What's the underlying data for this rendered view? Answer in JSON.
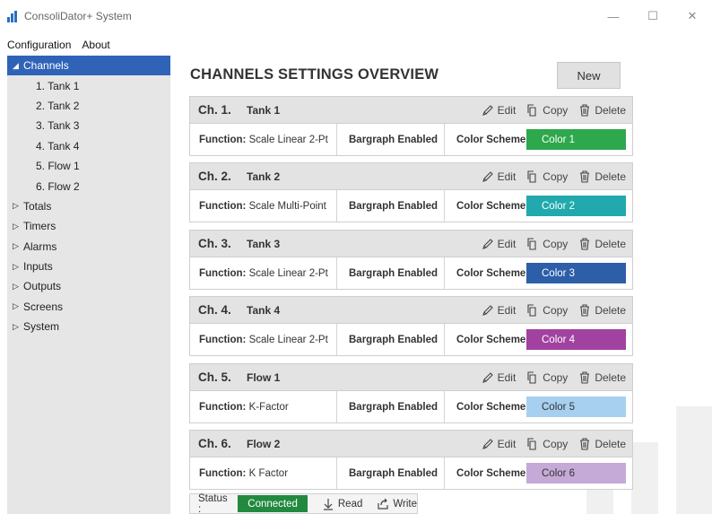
{
  "window": {
    "title": "ConsoliDator+ System",
    "minimize": "—",
    "maximize": "☐",
    "close": "✕"
  },
  "menu": {
    "items": [
      "Configuration",
      "About"
    ]
  },
  "sidebar": {
    "channels_label": "Channels",
    "channel_items": [
      "1. Tank 1",
      "2. Tank 2",
      "3. Tank  3",
      "4. Tank 4",
      "5. Flow 1",
      "6. Flow 2"
    ],
    "groups": [
      "Totals",
      "Timers",
      "Alarms",
      "Inputs",
      "Outputs",
      "Screens",
      "System"
    ]
  },
  "main": {
    "title": "CHANNELS SETTINGS OVERVIEW",
    "new_label": "New",
    "labels": {
      "edit": "Edit",
      "copy": "Copy",
      "delete": "Delete",
      "function": "Function:",
      "color_scheme": "Color Scheme:"
    },
    "channels": [
      {
        "num": "Ch. 1.",
        "name": "Tank 1",
        "function": "Scale Linear 2-Pt",
        "bargraph": "Bargraph Enabled",
        "color_label": "Color 1",
        "color": "#2ea84c",
        "text_color": "#ffffff"
      },
      {
        "num": "Ch. 2.",
        "name": "Tank 2",
        "function": "Scale Multi-Point",
        "bargraph": "Bargraph Enabled",
        "color_label": "Color 2",
        "color": "#22a9ad",
        "text_color": "#ffffff"
      },
      {
        "num": "Ch. 3.",
        "name": "Tank  3",
        "function": "Scale Linear 2-Pt",
        "bargraph": "Bargraph Enabled",
        "color_label": "Color 3",
        "color": "#2d5ea8",
        "text_color": "#ffffff"
      },
      {
        "num": "Ch. 4.",
        "name": "Tank 4",
        "function": "Scale Linear 2-Pt",
        "bargraph": "Bargraph Enabled",
        "color_label": "Color 4",
        "color": "#a142a1",
        "text_color": "#ffffff"
      },
      {
        "num": "Ch. 5.",
        "name": "Flow 1",
        "function": "K-Factor",
        "bargraph": "Bargraph Enabled",
        "color_label": "Color 5",
        "color": "#a7d0f0",
        "text_color": "#333333"
      },
      {
        "num": "Ch. 6.",
        "name": "Flow 2",
        "function": "K Factor",
        "bargraph": "Bargraph Enabled",
        "color_label": "Color 6",
        "color": "#c5a9d6",
        "text_color": "#333333"
      }
    ]
  },
  "status": {
    "label": "Status :",
    "value": "Connected",
    "read_label": "Read",
    "write_label": "Write",
    "connected_color": "#218a3e"
  }
}
